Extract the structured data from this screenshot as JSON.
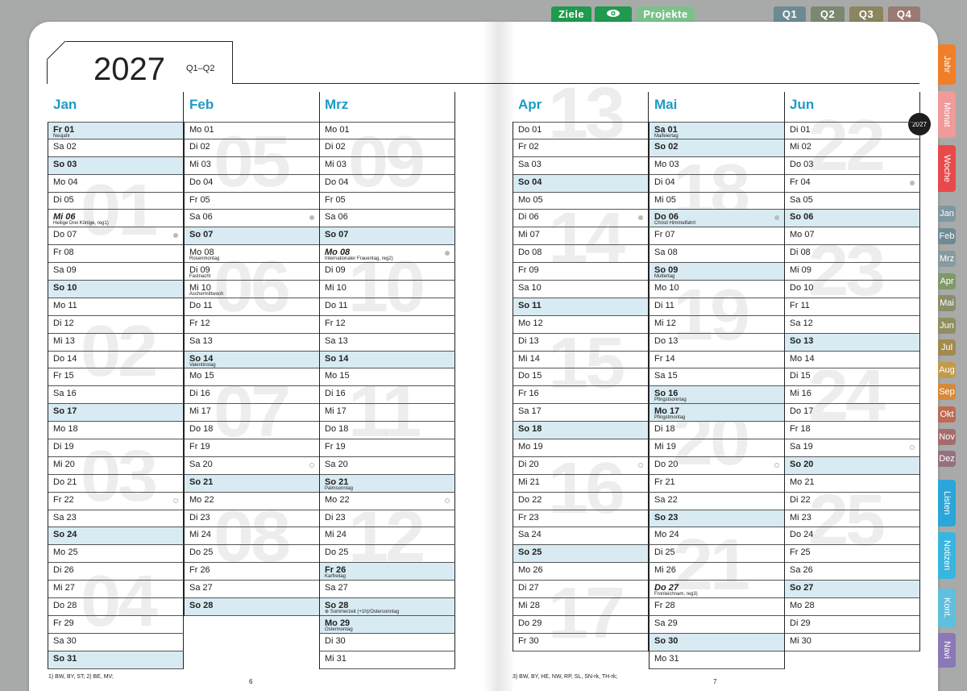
{
  "top_tabs": {
    "ziele": "Ziele",
    "projekte": "Projekte",
    "q1": "Q1",
    "q2": "Q2",
    "q3": "Q3",
    "q4": "Q4"
  },
  "side_tabs": [
    "Jahr",
    "Monat",
    "Woche",
    "Jan",
    "Feb",
    "Mrz",
    "Apr",
    "Mai",
    "Jun",
    "Jul",
    "Aug",
    "Sep",
    "Okt",
    "Nov",
    "Dez",
    "Listen",
    "Notizen",
    "Kont.",
    "Navi"
  ],
  "header": {
    "year": "2027",
    "quarter": "Q1–Q2",
    "badge": "2027"
  },
  "footer": {
    "left_note": "1) BW, BY, ST;   2) BE, MV;",
    "right_note": "3) BW, BY, HE, NW, RP, SL, SN-rk, TH-rk;",
    "page_left": "6",
    "page_right": "7"
  },
  "week_numbers": [
    "01",
    "02",
    "03",
    "04",
    "05",
    "06",
    "07",
    "08",
    "09",
    "10",
    "11",
    "12",
    "13",
    "14",
    "15",
    "16",
    "17",
    "18",
    "19",
    "20",
    "21",
    "22",
    "23",
    "24",
    "25"
  ],
  "months": [
    {
      "name": "Jan",
      "days": [
        {
          "t": "Fr 01",
          "h": "Neujahr",
          "hl": true
        },
        {
          "t": "Sa 02"
        },
        {
          "t": "So 03",
          "hl": true
        },
        {
          "t": "Mo 04"
        },
        {
          "t": "Di 05"
        },
        {
          "t": "Mi 06",
          "h": "Heilige Drei Könige, reg1)",
          "it": true
        },
        {
          "t": "Do 07",
          "dot": "f"
        },
        {
          "t": "Fr 08"
        },
        {
          "t": "Sa 09"
        },
        {
          "t": "So 10",
          "hl": true
        },
        {
          "t": "Mo 11"
        },
        {
          "t": "Di 12"
        },
        {
          "t": "Mi 13"
        },
        {
          "t": "Do 14"
        },
        {
          "t": "Fr 15"
        },
        {
          "t": "Sa 16"
        },
        {
          "t": "So 17",
          "hl": true
        },
        {
          "t": "Mo 18"
        },
        {
          "t": "Di 19"
        },
        {
          "t": "Mi 20"
        },
        {
          "t": "Do 21"
        },
        {
          "t": "Fr 22",
          "dot": "o"
        },
        {
          "t": "Sa 23"
        },
        {
          "t": "So 24",
          "hl": true
        },
        {
          "t": "Mo 25"
        },
        {
          "t": "Di 26"
        },
        {
          "t": "Mi 27"
        },
        {
          "t": "Do 28"
        },
        {
          "t": "Fr 29"
        },
        {
          "t": "Sa 30"
        },
        {
          "t": "So 31",
          "hl": true
        }
      ]
    },
    {
      "name": "Feb",
      "days": [
        {
          "t": "Mo 01"
        },
        {
          "t": "Di 02"
        },
        {
          "t": "Mi 03"
        },
        {
          "t": "Do 04"
        },
        {
          "t": "Fr 05"
        },
        {
          "t": "Sa 06",
          "dot": "f"
        },
        {
          "t": "So 07",
          "hl": true
        },
        {
          "t": "Mo 08",
          "h": "Rosenmontag"
        },
        {
          "t": "Di 09",
          "h": "Fastnacht"
        },
        {
          "t": "Mi 10",
          "h": "Aschermittwoch"
        },
        {
          "t": "Do 11"
        },
        {
          "t": "Fr 12"
        },
        {
          "t": "Sa 13"
        },
        {
          "t": "So 14",
          "h": "Valentinstag",
          "hl": true
        },
        {
          "t": "Mo 15"
        },
        {
          "t": "Di 16"
        },
        {
          "t": "Mi 17"
        },
        {
          "t": "Do 18"
        },
        {
          "t": "Fr 19"
        },
        {
          "t": "Sa 20",
          "dot": "o"
        },
        {
          "t": "So 21",
          "hl": true
        },
        {
          "t": "Mo 22"
        },
        {
          "t": "Di 23"
        },
        {
          "t": "Mi 24"
        },
        {
          "t": "Do 25"
        },
        {
          "t": "Fr 26"
        },
        {
          "t": "Sa 27"
        },
        {
          "t": "So 28",
          "hl": true
        }
      ]
    },
    {
      "name": "Mrz",
      "days": [
        {
          "t": "Mo 01"
        },
        {
          "t": "Di 02"
        },
        {
          "t": "Mi 03"
        },
        {
          "t": "Do 04"
        },
        {
          "t": "Fr 05"
        },
        {
          "t": "Sa 06"
        },
        {
          "t": "So 07",
          "hl": true
        },
        {
          "t": "Mo 08",
          "h": "Internationaler Frauentag, reg2)",
          "it": true,
          "dot": "f"
        },
        {
          "t": "Di 09"
        },
        {
          "t": "Mi 10"
        },
        {
          "t": "Do 11"
        },
        {
          "t": "Fr 12"
        },
        {
          "t": "Sa 13"
        },
        {
          "t": "So 14",
          "hl": true
        },
        {
          "t": "Mo 15"
        },
        {
          "t": "Di 16"
        },
        {
          "t": "Mi 17"
        },
        {
          "t": "Do 18"
        },
        {
          "t": "Fr 19"
        },
        {
          "t": "Sa 20"
        },
        {
          "t": "So 21",
          "h": "Palmsonntag",
          "hl": true
        },
        {
          "t": "Mo 22",
          "dot": "o"
        },
        {
          "t": "Di 23"
        },
        {
          "t": "Mi 24"
        },
        {
          "t": "Do 25"
        },
        {
          "t": "Fr 26",
          "h": "Karfreitag",
          "hl": true
        },
        {
          "t": "Sa 27"
        },
        {
          "t": "So 28",
          "h": "⊕ Sommerzeit (+1h)/Ostersonntag",
          "hl": true
        },
        {
          "t": "Mo 29",
          "h": "Ostermontag",
          "hl": true
        },
        {
          "t": "Di 30"
        },
        {
          "t": "Mi 31"
        }
      ]
    },
    {
      "name": "Apr",
      "days": [
        {
          "t": "Do 01"
        },
        {
          "t": "Fr 02"
        },
        {
          "t": "Sa 03"
        },
        {
          "t": "So 04",
          "hl": true
        },
        {
          "t": "Mo 05"
        },
        {
          "t": "Di 06",
          "dot": "f"
        },
        {
          "t": "Mi 07"
        },
        {
          "t": "Do 08"
        },
        {
          "t": "Fr 09"
        },
        {
          "t": "Sa 10"
        },
        {
          "t": "So 11",
          "hl": true
        },
        {
          "t": "Mo 12"
        },
        {
          "t": "Di 13"
        },
        {
          "t": "Mi 14"
        },
        {
          "t": "Do 15"
        },
        {
          "t": "Fr 16"
        },
        {
          "t": "Sa 17"
        },
        {
          "t": "So 18",
          "hl": true
        },
        {
          "t": "Mo 19"
        },
        {
          "t": "Di 20",
          "dot": "o"
        },
        {
          "t": "Mi 21"
        },
        {
          "t": "Do 22"
        },
        {
          "t": "Fr 23"
        },
        {
          "t": "Sa 24"
        },
        {
          "t": "So 25",
          "hl": true
        },
        {
          "t": "Mo 26"
        },
        {
          "t": "Di 27"
        },
        {
          "t": "Mi 28"
        },
        {
          "t": "Do 29"
        },
        {
          "t": "Fr 30"
        }
      ]
    },
    {
      "name": "Mai",
      "days": [
        {
          "t": "Sa 01",
          "h": "Maifeiertag",
          "hl": true
        },
        {
          "t": "So 02",
          "hl": true
        },
        {
          "t": "Mo 03"
        },
        {
          "t": "Di 04"
        },
        {
          "t": "Mi 05"
        },
        {
          "t": "Do 06",
          "h": "Christi Himmelfahrt",
          "hl": true,
          "dot": "f"
        },
        {
          "t": "Fr 07"
        },
        {
          "t": "Sa 08"
        },
        {
          "t": "So 09",
          "h": "Muttertag",
          "hl": true
        },
        {
          "t": "Mo 10"
        },
        {
          "t": "Di 11"
        },
        {
          "t": "Mi 12"
        },
        {
          "t": "Do 13"
        },
        {
          "t": "Fr 14"
        },
        {
          "t": "Sa 15"
        },
        {
          "t": "So 16",
          "h": "Pfingstsonntag",
          "hl": true
        },
        {
          "t": "Mo 17",
          "h": "Pfingstmontag",
          "hl": true
        },
        {
          "t": "Di 18"
        },
        {
          "t": "Mi 19"
        },
        {
          "t": "Do 20",
          "dot": "o"
        },
        {
          "t": "Fr 21"
        },
        {
          "t": "Sa 22"
        },
        {
          "t": "So 23",
          "hl": true
        },
        {
          "t": "Mo 24"
        },
        {
          "t": "Di 25"
        },
        {
          "t": "Mi 26"
        },
        {
          "t": "Do 27",
          "h": "Fronleichnam, reg3)",
          "it": true
        },
        {
          "t": "Fr 28"
        },
        {
          "t": "Sa 29"
        },
        {
          "t": "So 30",
          "hl": true
        },
        {
          "t": "Mo 31"
        }
      ]
    },
    {
      "name": "Jun",
      "days": [
        {
          "t": "Di 01"
        },
        {
          "t": "Mi 02"
        },
        {
          "t": "Do 03"
        },
        {
          "t": "Fr 04",
          "dot": "f"
        },
        {
          "t": "Sa 05"
        },
        {
          "t": "So 06",
          "hl": true
        },
        {
          "t": "Mo 07"
        },
        {
          "t": "Di 08"
        },
        {
          "t": "Mi 09"
        },
        {
          "t": "Do 10"
        },
        {
          "t": "Fr 11"
        },
        {
          "t": "Sa 12"
        },
        {
          "t": "So 13",
          "hl": true
        },
        {
          "t": "Mo 14"
        },
        {
          "t": "Di 15"
        },
        {
          "t": "Mi 16"
        },
        {
          "t": "Do 17"
        },
        {
          "t": "Fr 18"
        },
        {
          "t": "Sa 19",
          "dot": "o"
        },
        {
          "t": "So 20",
          "hl": true
        },
        {
          "t": "Mo 21"
        },
        {
          "t": "Di 22"
        },
        {
          "t": "Mi 23"
        },
        {
          "t": "Do 24"
        },
        {
          "t": "Fr 25"
        },
        {
          "t": "Sa 26"
        },
        {
          "t": "So 27",
          "hl": true
        },
        {
          "t": "Mo 28"
        },
        {
          "t": "Di 29"
        },
        {
          "t": "Mi 30"
        }
      ]
    }
  ]
}
